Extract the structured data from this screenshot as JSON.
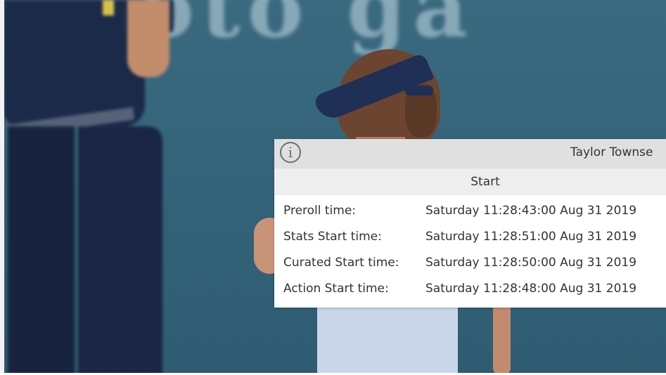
{
  "popup": {
    "player_name": "Taylor Townse",
    "info_icon": "info-icon",
    "section_title": "Start",
    "rows": [
      {
        "label": "Preroll time:",
        "value": "Saturday 11:28:43:00 Aug 31 2019"
      },
      {
        "label": "Stats Start time:",
        "value": "Saturday 11:28:51:00 Aug 31 2019"
      },
      {
        "label": "Curated Start time:",
        "value": "Saturday 11:28:50:00 Aug 31 2019"
      },
      {
        "label": "Action Start time:",
        "value": "Saturday 11:28:48:00 Aug 31 2019"
      }
    ]
  },
  "colors": {
    "header_bg": "#e0e0e0",
    "section_bg": "#eeeeee",
    "text": "#333333",
    "backdrop": "#34637a"
  }
}
